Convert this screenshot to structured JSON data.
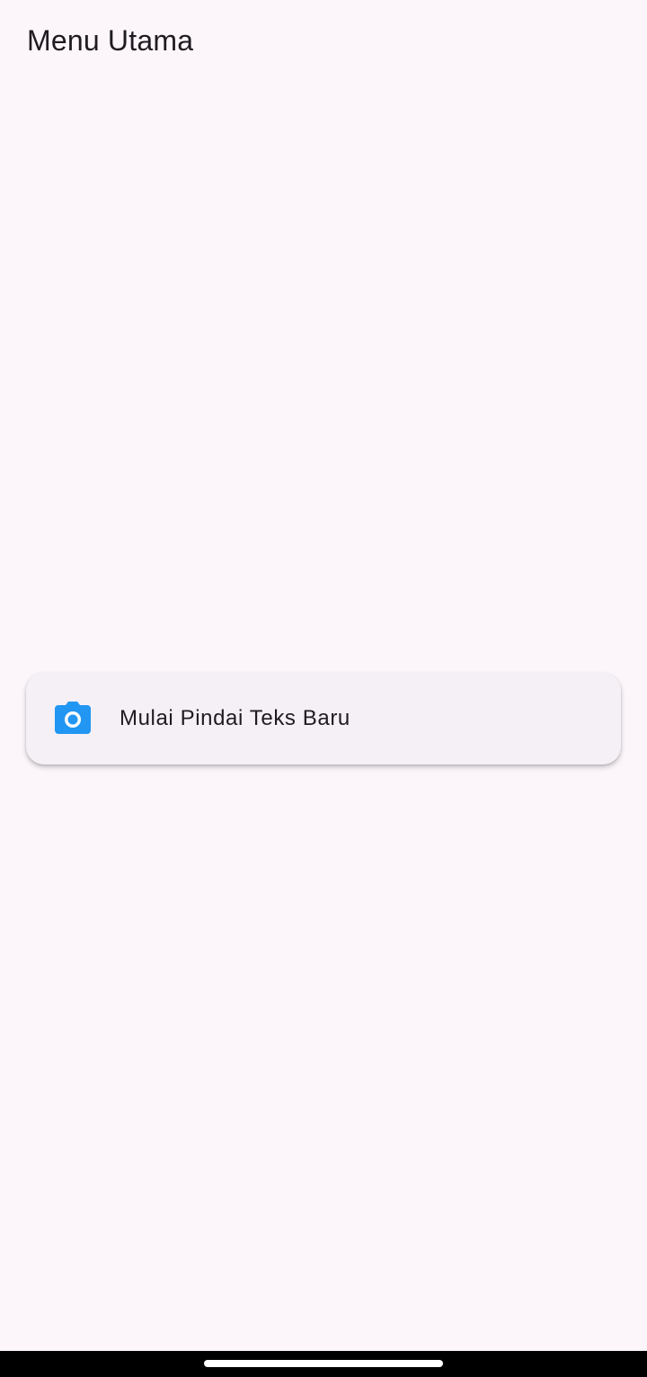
{
  "header": {
    "title": "Menu Utama"
  },
  "main": {
    "scan_card": {
      "label": "Mulai Pindai Teks Baru",
      "icon": "camera-icon"
    }
  },
  "colors": {
    "background": "#fcf6fb",
    "card": "#f4f0f5",
    "accent": "#2196f3",
    "text": "#1f1b20"
  }
}
